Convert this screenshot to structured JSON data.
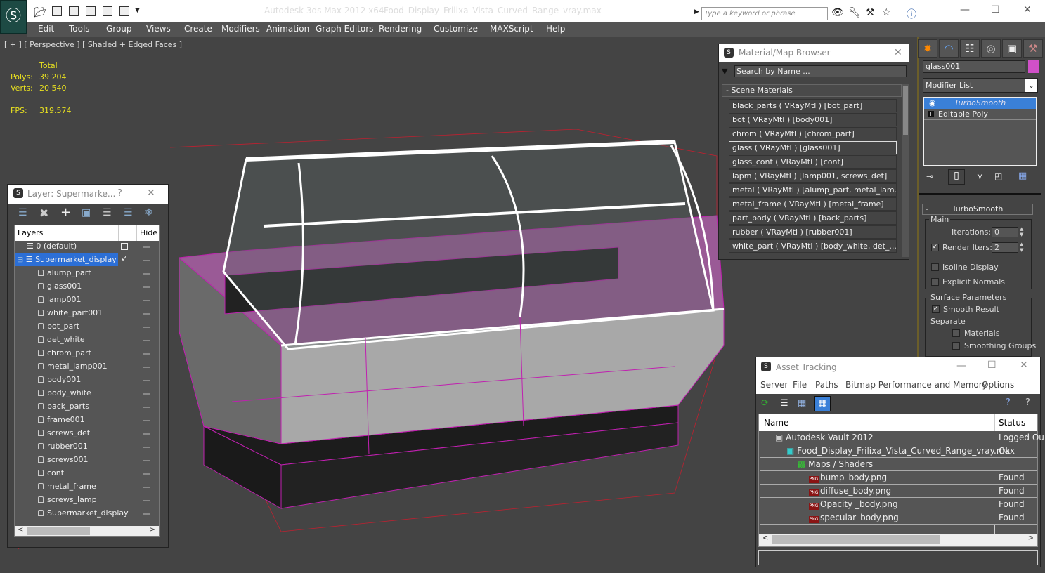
{
  "app": {
    "title": "Autodesk 3ds Max  2012 x64",
    "file": "Food_Display_Frilixa_Vista_Curved_Range_vray.max",
    "search_placeholder": "Type a keyword or phrase",
    "logo": "3ds-max-logo"
  },
  "menu": [
    "Edit",
    "Tools",
    "Group",
    "Views",
    "Create",
    "Modifiers",
    "Animation",
    "Graph Editors",
    "Rendering",
    "Customize",
    "MAXScript",
    "Help"
  ],
  "viewport": {
    "label": "[ + ] [ Perspective ] [ Shaded + Edged Faces ]",
    "stats": {
      "total_label": "Total",
      "polys_label": "Polys:",
      "polys": "39 204",
      "verts_label": "Verts:",
      "verts": "20 540",
      "fps_label": "FPS:",
      "fps": "319.574"
    },
    "wire_color": "#c020b0"
  },
  "layer_panel": {
    "title": "Layer: Supermarke...",
    "help": "?",
    "col_layers": "Layers",
    "col_hide": "Hide",
    "layers": [
      {
        "name": "0 (default)",
        "type": "layer"
      },
      {
        "name": "Supermarket_display",
        "type": "layer",
        "selected": true
      }
    ],
    "objects": [
      "alump_part",
      "glass001",
      "lamp001",
      "white_part001",
      "bot_part",
      "det_white",
      "chrom_part",
      "metal_lamp001",
      "body001",
      "body_white",
      "back_parts",
      "frame001",
      "screws_det",
      "rubber001",
      "screws001",
      "cont",
      "metal_frame",
      "screws_lamp",
      "Supermarket_display"
    ]
  },
  "material_browser": {
    "title": "Material/Map Browser",
    "search_placeholder": "Search by Name ...",
    "group": "- Scene Materials",
    "items": [
      "black_parts  ( VRayMtl )  [bot_part]",
      "bot  ( VRayMtl )  [body001]",
      "chrom  ( VRayMtl )  [chrom_part]",
      "glass  ( VRayMtl )  [glass001]",
      "glass_cont  ( VRayMtl )  [cont]",
      "lapm  ( VRayMtl )  [lamp001, screws_det]",
      "metal  ( VRayMtl )  [alump_part, metal_lam...",
      "metal_frame  ( VRayMtl )  [metal_frame]",
      "part_body  ( VRayMtl )  [back_parts]",
      "rubber  ( VRayMtl )  [rubber001]",
      "white_part  ( VRayMtl )  [body_white, det_..."
    ],
    "selected_index": 3
  },
  "command_panel": {
    "object_name": "glass001",
    "object_color": "#d050c8",
    "modifier_list": "Modifier List",
    "stack": [
      "TurboSmooth",
      "Editable Poly"
    ],
    "rollout": "TurboSmooth",
    "main": "Main",
    "iterations_label": "Iterations:",
    "iterations": "0",
    "render_iters_label": "Render Iters:",
    "render_iters": "2",
    "render_iters_checked": true,
    "isoline": "Isoline Display",
    "isoline_checked": false,
    "explicit": "Explicit Normals",
    "explicit_checked": false,
    "surface": "Surface Parameters",
    "smooth_result": "Smooth Result",
    "smooth_checked": true,
    "separate": "Separate",
    "materials": "Materials",
    "materials_checked": false,
    "smoothing_groups": "Smoothing Groups",
    "smoothing_checked": false
  },
  "asset_tracking": {
    "title": "Asset Tracking",
    "menu": [
      "Server",
      "File",
      "Paths",
      "Bitmap Performance and Memory",
      "Options"
    ],
    "col_name": "Name",
    "col_status": "Status",
    "rows": [
      {
        "name": "Autodesk Vault 2012",
        "status": "Logged Ou"
      },
      {
        "name": "Food_Display_Frilixa_Vista_Curved_Range_vray.max",
        "status": "Ok"
      },
      {
        "name": "Maps / Shaders",
        "status": ""
      },
      {
        "name": "bump_body.png",
        "status": "Found"
      },
      {
        "name": "diffuse_body.png",
        "status": "Found"
      },
      {
        "name": "Opacity _body.png",
        "status": "Found"
      },
      {
        "name": "specular_body.png",
        "status": "Found"
      }
    ]
  }
}
